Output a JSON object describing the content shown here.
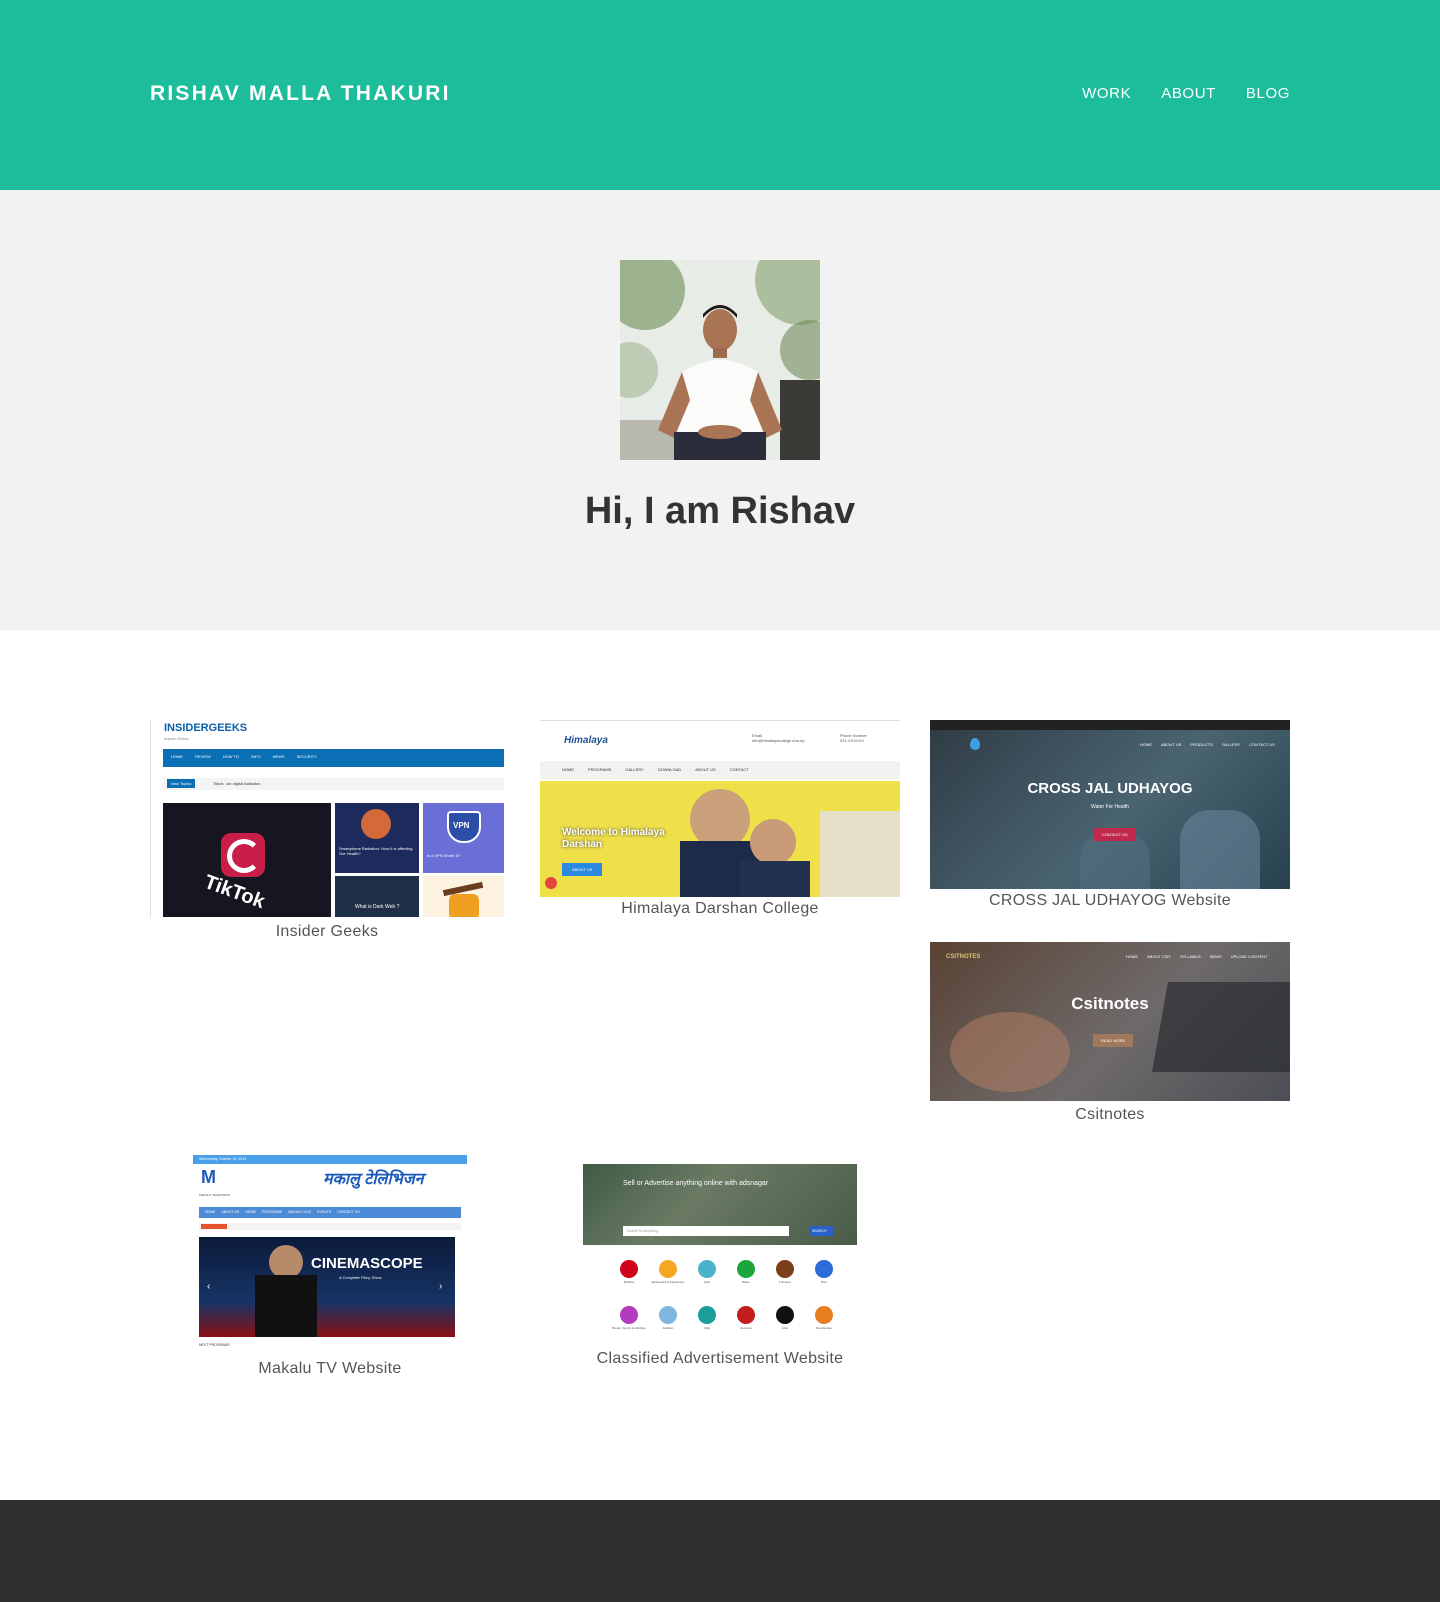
{
  "header": {
    "brand": "RISHAV MALLA THAKURI",
    "nav": [
      "WORK",
      "ABOUT",
      "BLOG"
    ],
    "color": "#1dbd9b"
  },
  "hero": {
    "title": "Hi, I am Rishav",
    "background": "#f2f2f2"
  },
  "portfolio": [
    {
      "caption": "Insider Geeks",
      "site_logo": "INSIDERGEEKS",
      "site_tag": "Insider Geeks",
      "site_menu": [
        "HOME",
        "REVIEW",
        "HOW TO",
        "INFO",
        "NEWS",
        "SECURITY"
      ],
      "ticker_label": "New Topics",
      "ticker_text": "Tiktok : An digital Addiction",
      "tile_text": [
        "TikTok",
        "Smartphone Radiation- How it is affecting Our Health?",
        "VPN",
        "Is a VPN Worth It?",
        "What is Dark Web ?"
      ]
    },
    {
      "caption": "Himalaya Darshan College",
      "site_logo": "Himalaya",
      "site_menu": [
        "HOME",
        "PROGRAMS",
        "GALLERY",
        "DOWNLOAD",
        "ABOUT US",
        "CONTACT"
      ],
      "site_contact": [
        "Email",
        "info@himalayacollege.edu.np",
        "Phone Number",
        "021-XXXXXX"
      ],
      "banner": "Welcome to Himalaya Darshan",
      "button": "ABOUT US"
    },
    {
      "caption": "CROSS JAL UDHAYOG Website",
      "banner": "CROSS JAL UDHAYOG",
      "tagline": "Water For Health",
      "button": "CONTACT US",
      "site_menu": [
        "HOME",
        "ABOUT US",
        "PRODUCTS",
        "GALLERY",
        "CONTACT US"
      ]
    },
    {
      "caption": "Csitnotes",
      "site_logo": "CSITNOTES",
      "banner": "Csitnotes",
      "button": "READ MORE",
      "site_menu": [
        "HOME",
        "ABOUT CSIT",
        "SYLLABUS",
        "NEWS",
        "UPLOAD CONTENT"
      ]
    },
    {
      "caption": "Makalu TV Website",
      "date": "Wednesday, October 24, 2019",
      "site_logo": "M",
      "logo_sub": "MAKALU TELEVISION",
      "nepali_title": "मकालु टेलिभिजन",
      "site_menu": [
        "HOME",
        "ABOUT US",
        "NEWS",
        "PROGRAMS",
        "MAKALU LIVE",
        "EVENTS",
        "CONTACT US"
      ],
      "banner": "CINEMASCOPE",
      "banner_sub": "A Complete Filmy Show",
      "footer_text": "NEXT PROGRAMS"
    },
    {
      "caption": "Classified Advertisement Website",
      "headline": "Sell or Advertise anything online with adsnagar",
      "search_placeholder": "Search for Anything...",
      "search_button": "SEARCH",
      "categories": [
        "Mobiles",
        "Electronics & Appliances",
        "Cars",
        "Bikes",
        "Furniture",
        "Pets",
        "Books, Sports & Hobbies",
        "Fashion",
        "Kids",
        "Services",
        "Jobs",
        "Real Estate"
      ],
      "category_colors": [
        "#d0021b",
        "#f5a623",
        "#4ab3c9",
        "#1aa63b",
        "#7b3f1a",
        "#2b6cd8",
        "#b43bbd",
        "#7fb6e0",
        "#1b9e9a",
        "#c41d1d",
        "#111111",
        "#e67e22"
      ]
    }
  ]
}
